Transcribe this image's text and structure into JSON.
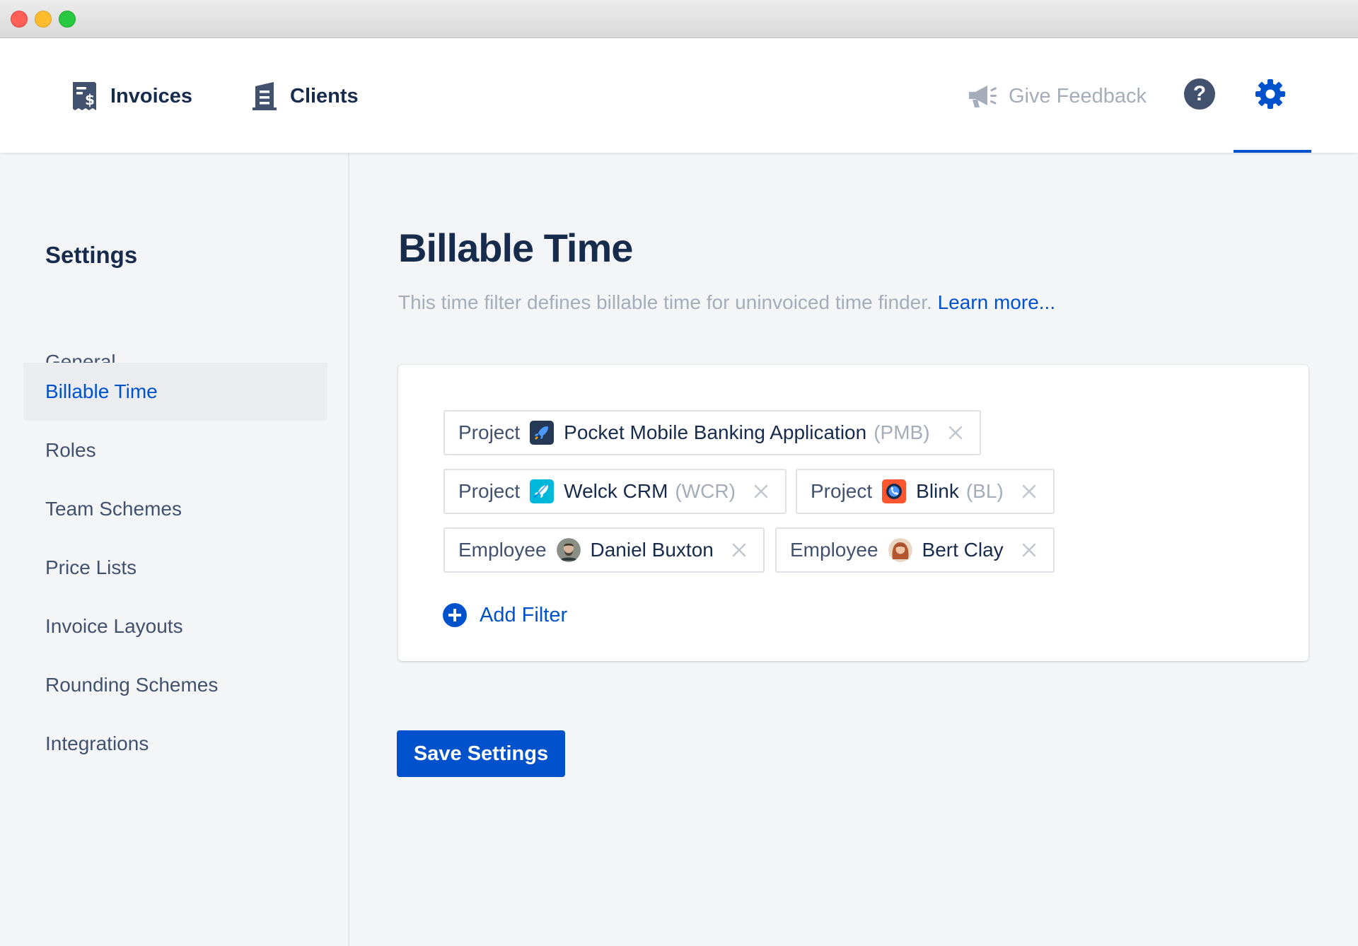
{
  "window": {
    "controls": [
      "close",
      "minimize",
      "maximize"
    ]
  },
  "topnav": {
    "items": [
      {
        "label": "Invoices",
        "icon": "invoice-icon"
      },
      {
        "label": "Clients",
        "icon": "building-icon"
      }
    ],
    "feedback_label": "Give Feedback",
    "feedback_icon": "megaphone-icon",
    "help_glyph": "?",
    "active_item": "settings",
    "accent_color": "#0052cc"
  },
  "sidebar": {
    "title": "Settings",
    "items": [
      {
        "label": "General",
        "active": false
      },
      {
        "label": "Billable Time",
        "active": true
      },
      {
        "label": "Roles",
        "active": false
      },
      {
        "label": "Team Schemes",
        "active": false
      },
      {
        "label": "Price Lists",
        "active": false
      },
      {
        "label": "Invoice Layouts",
        "active": false
      },
      {
        "label": "Rounding Schemes",
        "active": false
      },
      {
        "label": "Integrations",
        "active": false
      }
    ]
  },
  "main": {
    "title": "Billable Time",
    "description": "This time filter defines billable time for uninvoiced time finder.",
    "learn_more": "Learn more...",
    "filters": [
      {
        "type": "Project",
        "name": "Pocket Mobile Banking Application",
        "key": "(PMB)",
        "icon": "rocket-project-icon"
      },
      {
        "type": "Project",
        "name": "Welck CRM",
        "key": "(WCR)",
        "icon": "rocket-project-icon"
      },
      {
        "type": "Project",
        "name": "Blink",
        "key": "(BL)",
        "icon": "phone-project-icon"
      },
      {
        "type": "Employee",
        "name": "Daniel Buxton",
        "key": "",
        "icon": "avatar"
      },
      {
        "type": "Employee",
        "name": "Bert Clay",
        "key": "",
        "icon": "avatar"
      }
    ],
    "add_filter_label": "Add Filter",
    "save_label": "Save Settings"
  }
}
